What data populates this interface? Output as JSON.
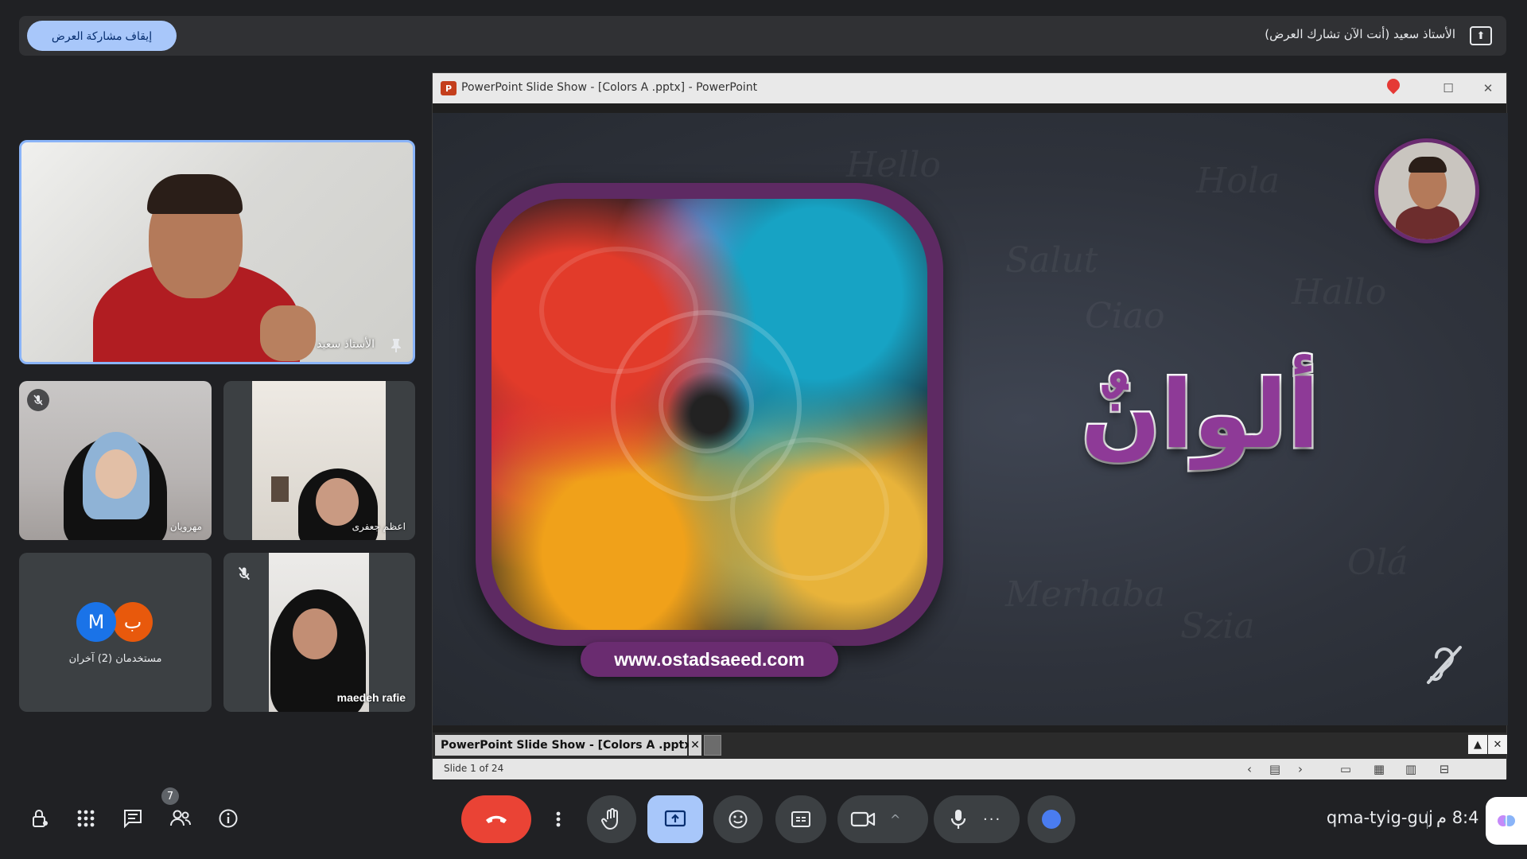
{
  "presenting_bar": {
    "status_text": "الأستاذ سعيد (أنت الآن تشارك العرض)",
    "stop_button_label": "إيقاف مشاركة العرض",
    "icon": "present-screen-icon"
  },
  "participants": {
    "main": {
      "name": "الأستاذ سعيد",
      "pinned": true
    },
    "tiles": [
      {
        "name": "مهرويان",
        "muted": true
      },
      {
        "name": "اعظم جعفری",
        "muted": false
      },
      {
        "label": "مستخدمان (2) آخران",
        "avatars": [
          "M",
          "ب"
        ],
        "avatar_colors": [
          "#1a73e8",
          "#e8590c"
        ]
      },
      {
        "name": "maedeh rafie",
        "muted": true
      }
    ]
  },
  "powerpoint": {
    "window_title": "PowerPoint Slide Show - [Colors A .pptx] - PowerPoint",
    "logo_letter": "P",
    "slide": {
      "title": "ألوانٌ",
      "url": "www.ostadsaeed.com",
      "background_words": [
        "Hello",
        "Salut",
        "Hola",
        "Ciao",
        "Hallo",
        "Olá",
        "Merhaba",
        "Szia"
      ]
    },
    "taskbar_tab": "PowerPoint Slide Show - [Colors A .pptx]",
    "status": "Slide 1 of 24"
  },
  "bottom_bar": {
    "people_count": "7",
    "meeting_code": "qma-tyig-guj",
    "clock": "8:4 م",
    "icons_left": [
      "host-controls-icon",
      "activities-icon",
      "chat-icon",
      "people-icon",
      "info-icon"
    ],
    "controls": [
      "end-call",
      "more-options",
      "raise-hand",
      "present",
      "reactions",
      "captions",
      "camera",
      "camera-options",
      "microphone",
      "mic-options",
      "effects"
    ]
  },
  "colors": {
    "accent": "#a8c7fa",
    "end_call": "#ea4335",
    "slide_purple": "#8e3a97",
    "frame_purple": "#6a2c70"
  }
}
